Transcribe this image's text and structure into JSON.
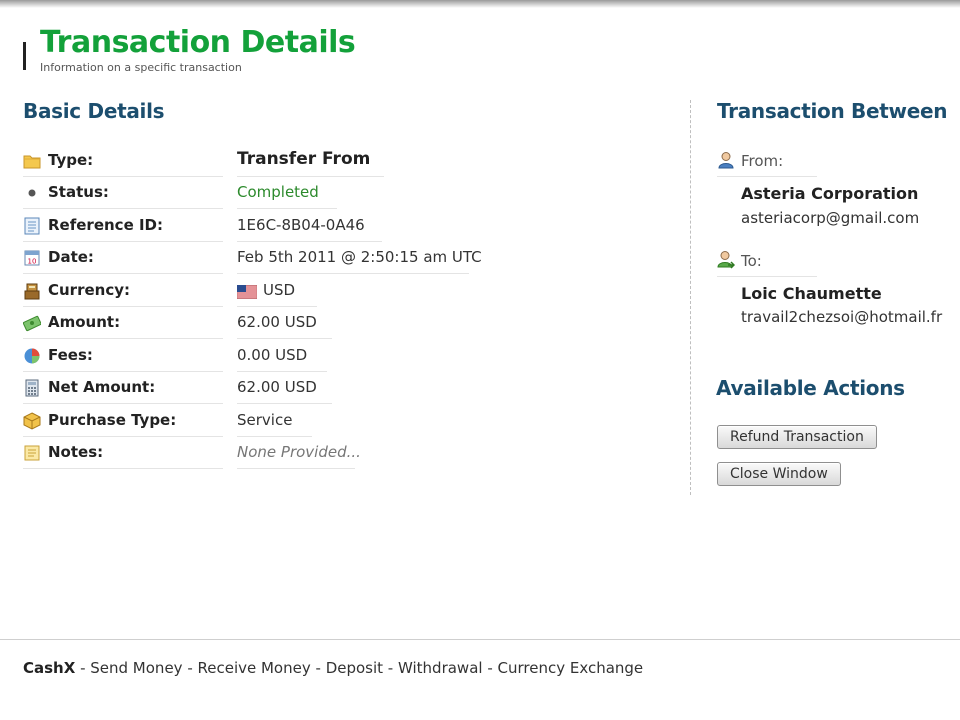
{
  "header": {
    "title": "Transaction Details",
    "subtitle": "Information on a specific transaction"
  },
  "basic": {
    "title": "Basic Details",
    "rows": [
      {
        "label": "Type:",
        "value": "Transfer From",
        "icon": "folder-icon"
      },
      {
        "label": "Status:",
        "value": "Completed",
        "icon": "bullet-icon"
      },
      {
        "label": "Reference ID:",
        "value": "1E6C-8B04-0A46",
        "icon": "document-icon"
      },
      {
        "label": "Date:",
        "value": "Feb 5th 2011 @ 2:50:15 am UTC",
        "icon": "calendar-icon"
      },
      {
        "label": "Currency:",
        "value": "USD",
        "icon": "cash-register-icon",
        "flag": "us-flag-icon"
      },
      {
        "label": "Amount:",
        "value": "62.00 USD",
        "icon": "money-icon"
      },
      {
        "label": "Fees:",
        "value": "0.00 USD",
        "icon": "pie-chart-icon"
      },
      {
        "label": "Net Amount:",
        "value": "62.00 USD",
        "icon": "calculator-icon"
      },
      {
        "label": "Purchase Type:",
        "value": "Service",
        "icon": "box-icon"
      },
      {
        "label": "Notes:",
        "value": "None Provided...",
        "icon": "note-icon"
      }
    ]
  },
  "between": {
    "title": "Transaction Between",
    "from": {
      "label": "From:",
      "name": "Asteria Corporation",
      "email": "asteriacorp@gmail.com",
      "icon": "user-icon"
    },
    "to": {
      "label": "To:",
      "name": "Loic Chaumette",
      "email": "travail2chezsoi@hotmail.fr",
      "icon": "user-arrow-icon"
    }
  },
  "actions": {
    "title": "Available Actions",
    "refund": "Refund Transaction",
    "close": "Close Window"
  },
  "footer": {
    "brand": "CashX",
    "links": [
      "Send Money",
      "Receive Money",
      "Deposit",
      "Withdrawal",
      "Currency Exchange"
    ],
    "separator": " - "
  },
  "colors": {
    "title": "#13a13a",
    "section": "#1c4e6e",
    "status_completed": "#2c8a2c",
    "notes": "#777777"
  }
}
